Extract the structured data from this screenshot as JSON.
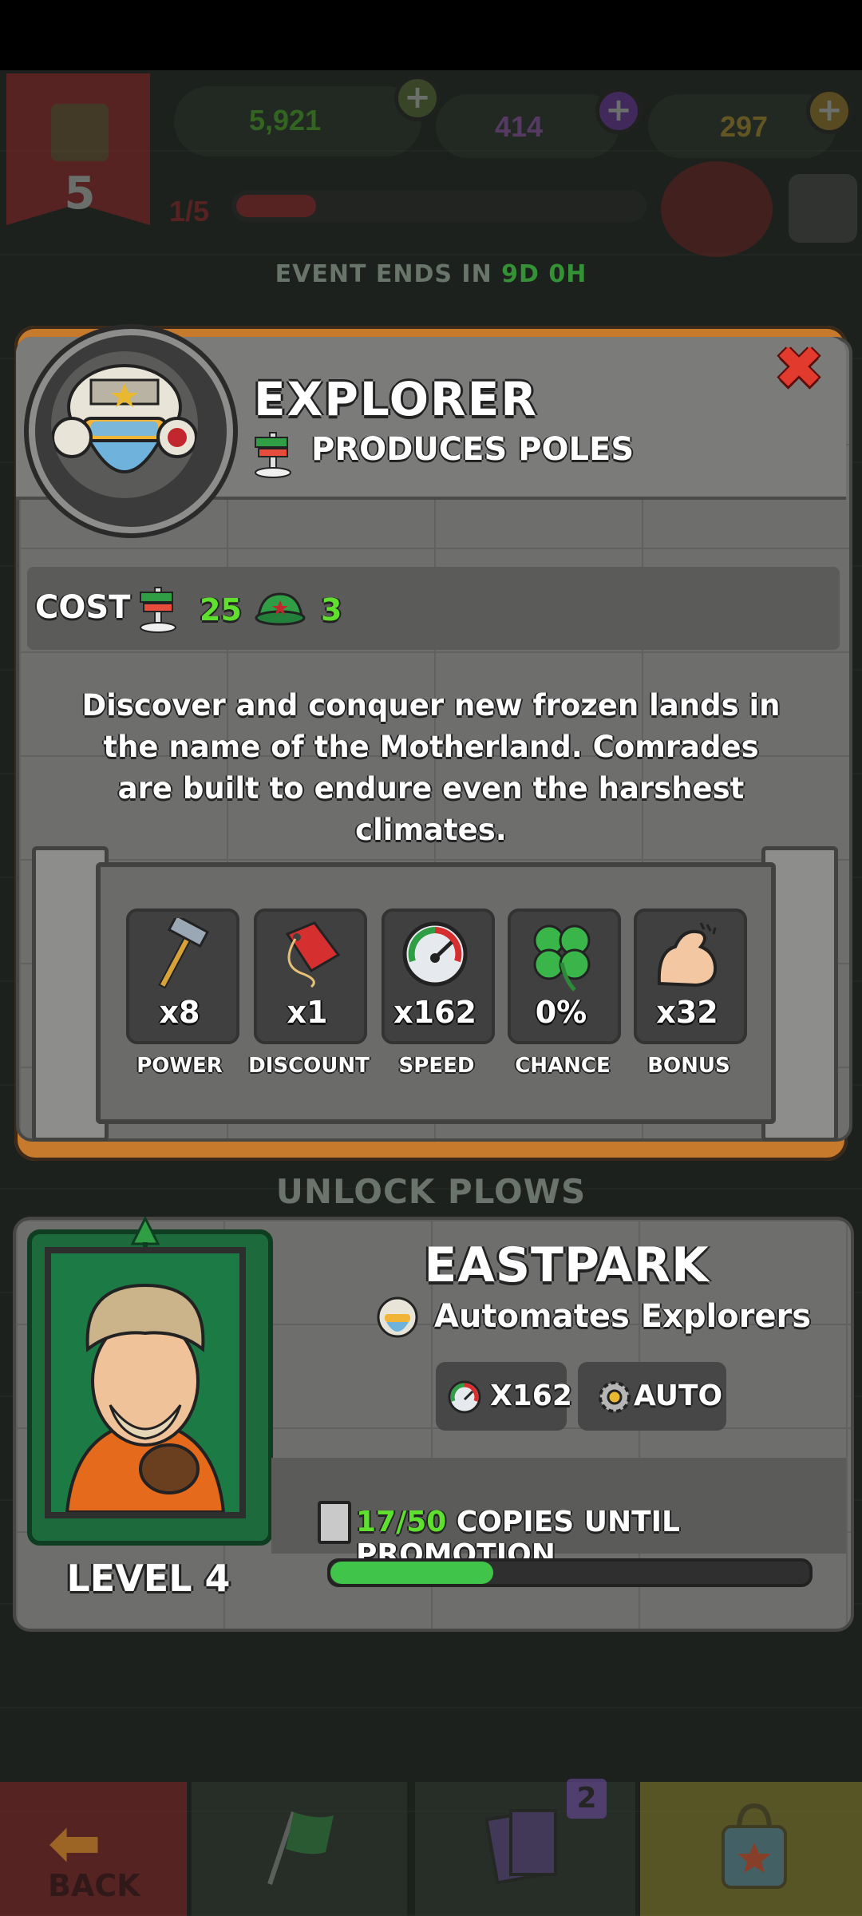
{
  "hud": {
    "level": "5",
    "currency_hats": "5,921",
    "currency_potions": "414",
    "currency_gold": "297",
    "level_progress": "1/5",
    "event_label": "EVENT ENDS IN",
    "event_time": "9D 0H"
  },
  "unit_info": {
    "title": "EXPLORER",
    "produces": "PRODUCES POLES",
    "cost_label": "COST",
    "cost_poles": "25",
    "cost_hats": "3",
    "description": "Discover and conquer new frozen lands in the name of the Motherland. Comrades are built to endure even the harshest climates.",
    "stats": [
      {
        "value": "x8",
        "label": "POWER",
        "icon": "hammer-icon"
      },
      {
        "value": "x1",
        "label": "DISCOUNT",
        "icon": "price-tag-icon"
      },
      {
        "value": "x162",
        "label": "SPEED",
        "icon": "speedometer-icon"
      },
      {
        "value": "0%",
        "label": "CHANCE",
        "icon": "clover-icon"
      },
      {
        "value": "x32",
        "label": "BONUS",
        "icon": "flexed-arm-icon"
      }
    ]
  },
  "section_label": "UNLOCK PLOWS",
  "manager": {
    "name": "EASTPARK",
    "role": "Automates Explorers",
    "speed_chip": "X162",
    "auto_chip": "AUTO",
    "level": "LEVEL 4",
    "copies_current": "17/50",
    "copies_label": "COPIES UNTIL PROMOTION",
    "copies_progress": 0.34
  },
  "nav": {
    "back_label": "BACK",
    "cards_badge": "2"
  },
  "colors": {
    "accent_green": "#5fe02e",
    "close_red": "#e33a2e",
    "wood": "#c77a2c",
    "stone": "#6e6e6c"
  }
}
